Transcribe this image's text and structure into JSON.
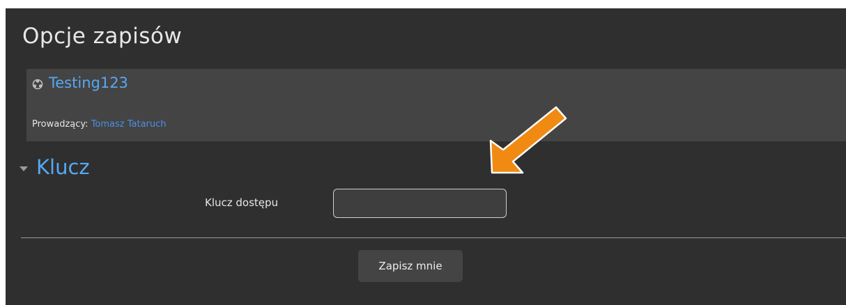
{
  "page": {
    "title": "Opcje zapisów"
  },
  "course": {
    "icon": "course-icon",
    "name": "Testing123",
    "teacher_label": "Prowadzący:",
    "teacher_name": "Tomasz Tataruch"
  },
  "enrol_section": {
    "icon": "caret-down-icon",
    "title": "Klucz",
    "field_label": "Klucz dostępu",
    "field_value": "",
    "submit_label": "Zapisz mnie"
  },
  "annotation": {
    "icon": "arrow-icon",
    "color": "#f08a12"
  },
  "colors": {
    "background": "#2f2f2f",
    "course_box": "#444444",
    "link": "#56a9f2",
    "annotation_arrow": "#f08a12"
  }
}
